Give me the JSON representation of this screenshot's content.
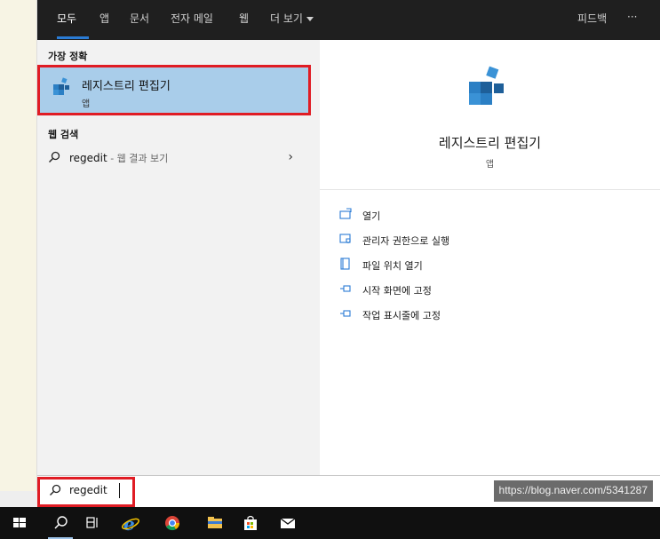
{
  "tabs": [
    {
      "label": "모두"
    },
    {
      "label": "앱"
    },
    {
      "label": "문서"
    },
    {
      "label": "전자 메일"
    },
    {
      "label": "웹"
    },
    {
      "label": "더 보기"
    }
  ],
  "feedback_label": "피드백",
  "more_options_label": "···",
  "best_match": {
    "section_label": "가장 정확",
    "title": "레지스트리 편집기",
    "subtitle": "앱"
  },
  "web_search": {
    "section_label": "웹 검색",
    "query": "regedit",
    "suffix": " - 웹 결과 보기"
  },
  "preview": {
    "title": "레지스트리 편집기",
    "subtitle": "앱",
    "actions": [
      {
        "label": "열기",
        "icon": "open-icon"
      },
      {
        "label": "관리자 권한으로 실행",
        "icon": "shield-icon"
      },
      {
        "label": "파일 위치 열기",
        "icon": "file-location-icon"
      },
      {
        "label": "시작 화면에 고정",
        "icon": "pin-icon"
      },
      {
        "label": "작업 표시줄에 고정",
        "icon": "pin-icon"
      }
    ]
  },
  "search": {
    "value": "regedit"
  },
  "watermark": "https://blog.naver.com/5341287",
  "colors": {
    "accent": "#2a7bd4",
    "highlight": "#e01c24",
    "selected_bg": "#a9cdea"
  }
}
